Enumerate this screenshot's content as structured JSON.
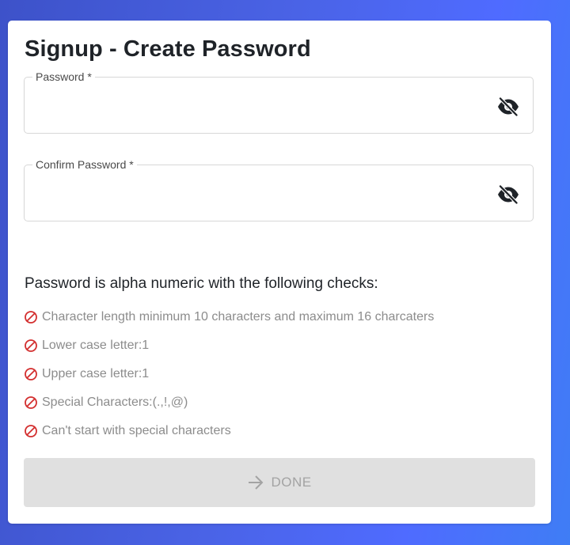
{
  "form": {
    "title": "Signup - Create Password",
    "password": {
      "label": "Password *",
      "value": "",
      "toggle_icon": "eye-off-icon"
    },
    "confirm_password": {
      "label": "Confirm Password *",
      "value": "",
      "toggle_icon": "eye-off-icon"
    }
  },
  "requirements": {
    "heading": "Password is alpha numeric with the following checks:",
    "status_icon": "prohibited-icon",
    "status_color": "#d32f2f",
    "items": [
      {
        "label": "Character length minimum 10 characters and maximum 16 charcaters",
        "met": false
      },
      {
        "label": "Lower case letter:1",
        "met": false
      },
      {
        "label": "Upper case letter:1",
        "met": false
      },
      {
        "label": "Special Characters:(.,!,@)",
        "met": false
      },
      {
        "label": "Can't start with special characters",
        "met": false
      }
    ]
  },
  "done_button": {
    "label": "DONE",
    "icon": "arrow-right-icon",
    "disabled": true
  },
  "colors": {
    "background_gradient_start": "#3d52c9",
    "background_gradient_end": "#4f6bff",
    "card": "#ffffff",
    "disabled_button": "#e0e0e0",
    "muted_text": "#8c8c8c"
  }
}
